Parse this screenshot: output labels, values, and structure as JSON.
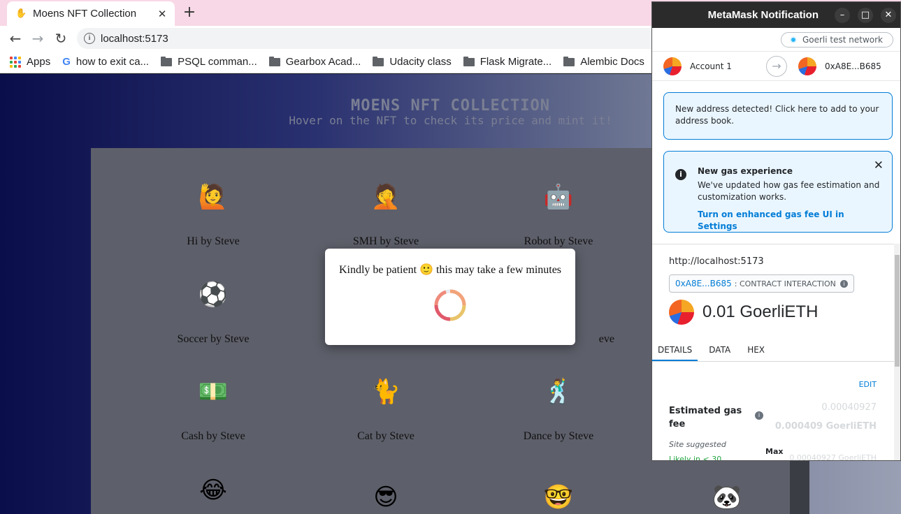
{
  "browser": {
    "tab_title": "Moens NFT Collection",
    "tab_close": "✕",
    "new_tab": "+",
    "back": "←",
    "forward": "→",
    "reload": "↻",
    "url": "localhost:5173",
    "bookmarks": [
      {
        "label": "Apps",
        "icon": "apps-icon"
      },
      {
        "label": "how to exit ca...",
        "icon": "google-icon"
      },
      {
        "label": "PSQL comman...",
        "icon": "folder-icon"
      },
      {
        "label": "Gearbox Acad...",
        "icon": "folder-icon"
      },
      {
        "label": "Udacity class",
        "icon": "folder-icon"
      },
      {
        "label": "Flask Migrate...",
        "icon": "folder-icon"
      },
      {
        "label": "Alembic Docs",
        "icon": "folder-icon"
      }
    ]
  },
  "page": {
    "title": "MOENS NFT COLLECTION",
    "subtitle": "Hover on the NFT to check its price and mint it!",
    "nfts": [
      {
        "caption": "Hi by Steve",
        "emoji": "🙋"
      },
      {
        "caption": "SMH by Steve",
        "emoji": "🤦"
      },
      {
        "caption": "Robot by Steve",
        "emoji": "🤖"
      },
      {
        "caption": "Soccer by Steve",
        "emoji": "⚽"
      },
      {
        "caption": "",
        "emoji": ""
      },
      {
        "caption": "eve",
        "emoji": ""
      },
      {
        "caption": "Cash by Steve",
        "emoji": "💵"
      },
      {
        "caption": "Cat by Steve",
        "emoji": "🐈"
      },
      {
        "caption": "Dance by Steve",
        "emoji": "🕺"
      },
      {
        "caption": "",
        "emoji": "😂"
      },
      {
        "caption": "",
        "emoji": "😎"
      },
      {
        "caption": "",
        "emoji": "🤓"
      },
      {
        "caption": "",
        "emoji": "🐼"
      }
    ],
    "modal_text_before": "Kindly be patient",
    "modal_emoji": "🙂",
    "modal_text_after": "this may take a few minutes"
  },
  "metamask": {
    "window_title": "MetaMask Notification",
    "minimize": "–",
    "maximize": "□",
    "close": "✕",
    "network": "Goerli test network",
    "account_name": "Account 1",
    "recipient": "0xA8E...B685",
    "notice_address": "New address detected! Click here to add to your address book.",
    "gas_notice_title": "New gas experience",
    "gas_notice_body": "We've updated how gas fee estimation and customization works.",
    "gas_notice_link": "Turn on enhanced gas fee UI in Settings",
    "origin": "http://localhost:5173",
    "contract_addr": "0xA8E...B685",
    "contract_label": ": CONTRACT INTERACTION",
    "amount": "0.01 GoerliETH",
    "tabs": [
      "DETAILS",
      "DATA",
      "HEX"
    ],
    "edit": "EDIT",
    "gas_label": "Estimated gas fee",
    "gas_value_small": "0.00040927",
    "gas_value_bold": "0.000409 GoerliETH",
    "site_suggested": "Site suggested",
    "likely": "Likely in < 30",
    "max_label": "Max",
    "max_value": "0.00040927 GoerliETH"
  },
  "colors": {
    "metamask_blue": "#037dd6",
    "page_gradient_start": "#0a0e4a",
    "gallery_bg": "#5d5f6a"
  }
}
